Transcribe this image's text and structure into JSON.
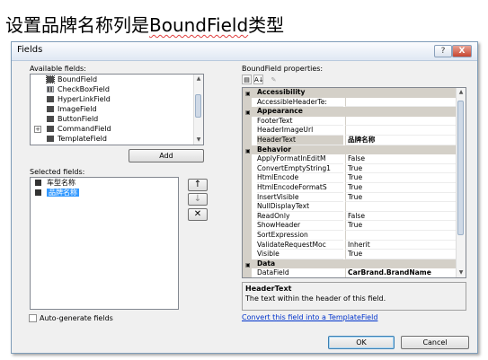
{
  "caption": {
    "prefix": "设置品牌名称列是",
    "emph": "BoundField",
    "suffix": "类型"
  },
  "dialog": {
    "title": "Fields",
    "help_glyph": "?",
    "close_glyph": "X",
    "available_label": "Available fields:",
    "available_fields": [
      {
        "label": "BoundField",
        "expander": ""
      },
      {
        "label": "CheckBoxField",
        "expander": ""
      },
      {
        "label": "HyperLinkField",
        "expander": ""
      },
      {
        "label": "ImageField",
        "expander": ""
      },
      {
        "label": "ButtonField",
        "expander": ""
      },
      {
        "label": "CommandField",
        "expander": "+"
      },
      {
        "label": "TemplateField",
        "expander": ""
      }
    ],
    "add_button": "Add",
    "selected_label": "Selected fields:",
    "selected_fields": [
      "车型名称",
      "品牌名称"
    ],
    "move_up": "↑",
    "move_down": "↓",
    "remove": "✕",
    "autogen_label": "Auto-generate fields",
    "props_label": "BoundField properties:",
    "toolbar": {
      "categorized": "▤",
      "alpha": "A↓",
      "pages": "✎"
    },
    "property_rows": [
      {
        "kind": "cat",
        "name": "Accessibility",
        "value": ""
      },
      {
        "kind": "prop",
        "name": "AccessibleHeaderTe:",
        "value": ""
      },
      {
        "kind": "cat",
        "name": "Appearance",
        "value": ""
      },
      {
        "kind": "prop",
        "name": "FooterText",
        "value": ""
      },
      {
        "kind": "prop",
        "name": "HeaderImageUrl",
        "value": ""
      },
      {
        "kind": "sel",
        "name": "HeaderText",
        "value": "品牌名称"
      },
      {
        "kind": "cat",
        "name": "Behavior",
        "value": ""
      },
      {
        "kind": "prop",
        "name": "ApplyFormatInEditM",
        "value": "False"
      },
      {
        "kind": "prop",
        "name": "ConvertEmptyString1",
        "value": "True"
      },
      {
        "kind": "prop",
        "name": "HtmlEncode",
        "value": "True"
      },
      {
        "kind": "prop",
        "name": "HtmlEncodeFormatS",
        "value": "True"
      },
      {
        "kind": "prop",
        "name": "InsertVisible",
        "value": "True"
      },
      {
        "kind": "prop",
        "name": "NullDisplayText",
        "value": ""
      },
      {
        "kind": "prop",
        "name": "ReadOnly",
        "value": "False"
      },
      {
        "kind": "prop",
        "name": "ShowHeader",
        "value": "True"
      },
      {
        "kind": "prop",
        "name": "SortExpression",
        "value": ""
      },
      {
        "kind": "prop",
        "name": "ValidateRequestMoc",
        "value": "Inherit"
      },
      {
        "kind": "prop",
        "name": "Visible",
        "value": "True"
      },
      {
        "kind": "cat",
        "name": "Data",
        "value": ""
      },
      {
        "kind": "bold",
        "name": "DataField",
        "value": "CarBrand.BrandName"
      }
    ],
    "description": {
      "title": "HeaderText",
      "text": "The text within the header of this field."
    },
    "convert_link": "Convert this field into a TemplateField",
    "ok_button": "OK",
    "cancel_button": "Cancel"
  }
}
